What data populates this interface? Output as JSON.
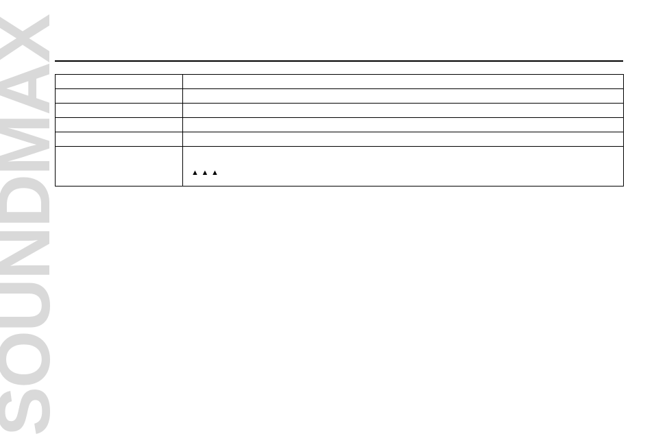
{
  "watermark": "SOUNDMAX",
  "eject_glyph": "▲",
  "rows": [
    {
      "label": "",
      "content": ""
    },
    {
      "label": "",
      "content": ""
    },
    {
      "label": "",
      "content": ""
    },
    {
      "label": "",
      "content": ""
    },
    {
      "label": "",
      "content": ""
    },
    {
      "label": "",
      "content_parts": [
        "",
        "",
        "",
        ""
      ]
    }
  ]
}
